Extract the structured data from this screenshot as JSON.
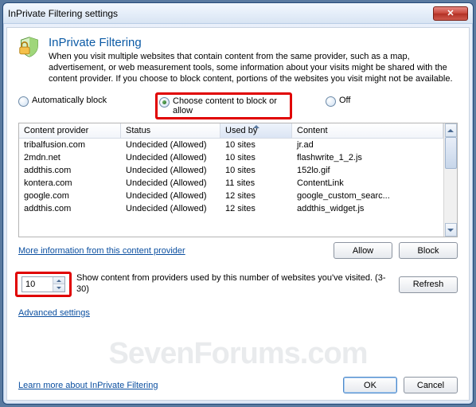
{
  "window": {
    "title": "InPrivate Filtering settings",
    "close_glyph": "✕"
  },
  "header": {
    "heading": "InPrivate Filtering",
    "description": "When you visit multiple websites that contain content from the same provider, such as a map, advertisement, or web measurement tools, some information about your visits might be shared with the content provider.  If you choose to block content, portions of the websites you visit might not be available."
  },
  "radios": {
    "auto": "Automatically block",
    "choose": "Choose content to block or allow",
    "off": "Off",
    "selected": "choose"
  },
  "table": {
    "headers": {
      "provider": "Content provider",
      "status": "Status",
      "usedby": "Used by",
      "content": "Content"
    },
    "rows": [
      {
        "provider": "tribalfusion.com",
        "status": "Undecided (Allowed)",
        "usedby": "10 sites",
        "content": "jr.ad"
      },
      {
        "provider": "2mdn.net",
        "status": "Undecided (Allowed)",
        "usedby": "10 sites",
        "content": "flashwrite_1_2.js"
      },
      {
        "provider": "addthis.com",
        "status": "Undecided (Allowed)",
        "usedby": "10 sites",
        "content": "152lo.gif"
      },
      {
        "provider": "kontera.com",
        "status": "Undecided (Allowed)",
        "usedby": "11 sites",
        "content": "ContentLink"
      },
      {
        "provider": "google.com",
        "status": "Undecided (Allowed)",
        "usedby": "12 sites",
        "content": "google_custom_searc..."
      },
      {
        "provider": "addthis.com",
        "status": "Undecided (Allowed)",
        "usedby": "12 sites",
        "content": "addthis_widget.js"
      }
    ]
  },
  "links": {
    "more_info": "More information from this content provider",
    "advanced": "Advanced settings",
    "learn_more": "Learn more about InPrivate Filtering"
  },
  "buttons": {
    "allow": "Allow",
    "block": "Block",
    "refresh": "Refresh",
    "ok": "OK",
    "cancel": "Cancel"
  },
  "threshold": {
    "value": "10",
    "label": "Show content from providers used by this number of websites you've visited. (3-30)"
  },
  "watermark": "SevenForums.com"
}
